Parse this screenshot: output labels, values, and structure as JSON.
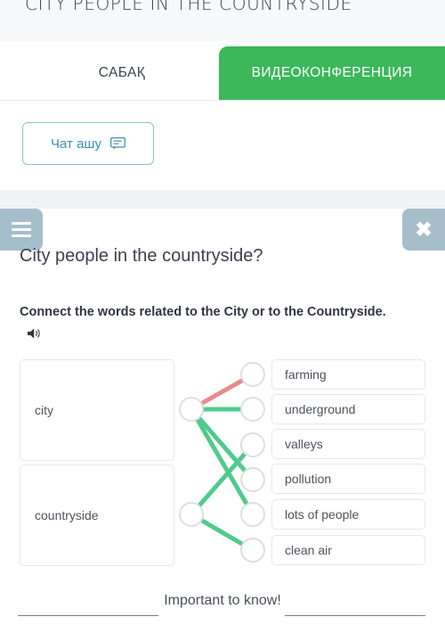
{
  "header": {
    "lesson_title": "CITY PEOPLE IN THE COUNTRYSIDE"
  },
  "tabs": [
    {
      "label": "САБАҚ",
      "active": false
    },
    {
      "label": "ВИДЕОКОНФЕРЕНЦИЯ",
      "active": true
    }
  ],
  "chat": {
    "button_label": "Чат ашу",
    "icon": "chat-bubble-icon"
  },
  "toolbar": {
    "menu_icon": "hamburger-menu-icon",
    "close_icon": "close-icon",
    "close_glyph": "✖"
  },
  "task": {
    "title": "City people in the countryside?",
    "instruction": "Connect the words related to the City or to the Countryside.",
    "audio_icon": "speaker-icon"
  },
  "exercise": {
    "type": "matching",
    "left_items": [
      {
        "id": "city",
        "label": "city"
      },
      {
        "id": "countryside",
        "label": "countryside"
      }
    ],
    "right_items": [
      {
        "id": "farming",
        "label": "farming"
      },
      {
        "id": "underground",
        "label": "underground"
      },
      {
        "id": "valleys",
        "label": "valleys"
      },
      {
        "id": "pollution",
        "label": "pollution"
      },
      {
        "id": "lots_of_people",
        "label": "lots of people"
      },
      {
        "id": "clean_air",
        "label": "clean air"
      }
    ],
    "connections": [
      {
        "from": "city",
        "to": "farming",
        "state": "incorrect",
        "color": "#e58b8b"
      },
      {
        "from": "city",
        "to": "underground",
        "state": "correct",
        "color": "#4ecb8d"
      },
      {
        "from": "city",
        "to": "pollution",
        "state": "correct",
        "color": "#4ecb8d"
      },
      {
        "from": "city",
        "to": "lots_of_people",
        "state": "correct",
        "color": "#4ecb8d"
      },
      {
        "from": "countryside",
        "to": "valleys",
        "state": "correct",
        "color": "#4ecb8d"
      },
      {
        "from": "countryside",
        "to": "clean_air",
        "state": "correct",
        "color": "#4ecb8d"
      }
    ],
    "node_color": "#dcdfe2"
  },
  "footer": {
    "text": "Important to know!"
  },
  "colors": {
    "accent_green": "#3cb75a",
    "tab_text": "#ffffff",
    "toolbar_bg": "#a6bdca",
    "chat_border": "#8ebfd6",
    "chat_text": "#3e8fb5",
    "connector_correct": "#4ecb8d",
    "connector_incorrect": "#e58b8b"
  }
}
